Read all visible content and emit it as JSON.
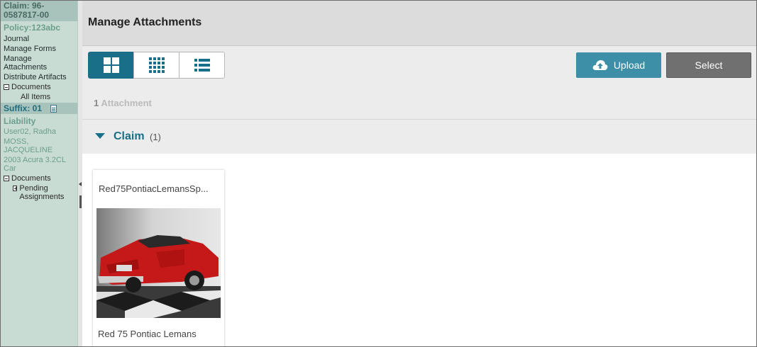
{
  "sidebar": {
    "claim": "Claim: 96-0587817-00",
    "policy": "Policy:123abc",
    "links": [
      "Journal",
      "Manage Forms",
      "Manage Attachments",
      "Distribute Artifacts"
    ],
    "documents": "Documents",
    "all_items": "All Items",
    "suffix": "Suffix: 01",
    "liability": "Liability",
    "user": "User02, Radha",
    "claimant": "MOSS, JACQUELINE",
    "vehicle": "2003 Acura 3.2CL Car",
    "documents2": "Documents",
    "pending": "Pending Assignments"
  },
  "header": {
    "title": "Manage Attachments"
  },
  "toolbar": {
    "views": [
      {
        "icon": "large-grid-icon",
        "active": true
      },
      {
        "icon": "small-grid-icon",
        "active": false
      },
      {
        "icon": "list-icon",
        "active": false
      }
    ],
    "upload_label": "Upload",
    "select_label": "Select",
    "count_num": "1",
    "count_label": "Attachment"
  },
  "group": {
    "title": "Claim",
    "count": "(1)"
  },
  "attachments": [
    {
      "filename": "Red75PontiacLemansSp...",
      "caption": "Red 75 Pontiac Lemans",
      "thumb": "red-car-photo"
    }
  ],
  "colors": {
    "accent": "#1a6f88",
    "upload": "#3d8ea7",
    "select": "#707070",
    "sidebar": "#c9dcd4"
  }
}
